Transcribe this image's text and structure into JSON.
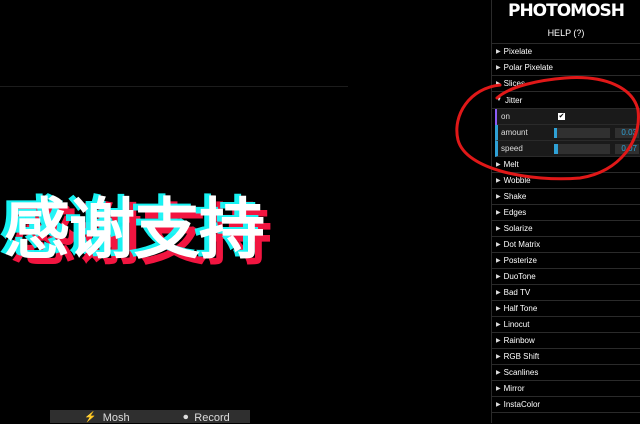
{
  "canvas": {
    "glitch_text": "感谢支持",
    "mosh_button": {
      "icon": "mosh-icon",
      "label": "Mosh"
    },
    "record_button": {
      "icon": "record-icon",
      "label": "Record"
    }
  },
  "panel": {
    "logo": "PHOTOMOSH",
    "help": "HELP (?)",
    "effects_before": [
      {
        "label": "Pixelate"
      },
      {
        "label": "Polar Pixelate"
      },
      {
        "label": "Slices"
      }
    ],
    "jitter": {
      "label": "Jitter",
      "on_label": "on",
      "on_checked": true,
      "amount_label": "amount",
      "amount_value": "0.03",
      "amount_fraction": 0.03,
      "speed_label": "speed",
      "speed_value": "0.07",
      "speed_fraction": 0.07
    },
    "effects_after": [
      {
        "label": "Melt"
      },
      {
        "label": "Wobble"
      },
      {
        "label": "Shake"
      },
      {
        "label": "Edges"
      },
      {
        "label": "Solarize"
      },
      {
        "label": "Dot Matrix"
      },
      {
        "label": "Posterize"
      },
      {
        "label": "DuoTone"
      },
      {
        "label": "Bad TV"
      },
      {
        "label": "Half Tone"
      },
      {
        "label": "Linocut"
      },
      {
        "label": "Rainbow"
      },
      {
        "label": "RGB Shift"
      },
      {
        "label": "Scanlines"
      },
      {
        "label": "Mirror"
      },
      {
        "label": "InstaColor"
      }
    ]
  },
  "colors": {
    "accent": "#2fa1d6",
    "annotation": "#e01818",
    "glitch_red": "#ff1744",
    "glitch_cyan": "#18ffff"
  }
}
